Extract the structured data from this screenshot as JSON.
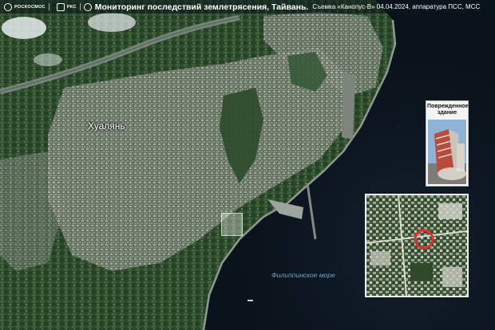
{
  "header": {
    "org_roscosmos": "РОСКОСМОС",
    "org_rks": "РКС",
    "title": "Мониторинг последствий землетрясения, Тайвань.",
    "subtitle": "Съемка «Канопус-В» 04.04.2024, аппаратура ПСС, МСС"
  },
  "labels": {
    "city": "Хуалянь",
    "sea": "Филиппинское море"
  },
  "inset_photo": {
    "caption": "Поврежденное здание"
  },
  "colors": {
    "sea": "#0d1620",
    "land_green": "#2e4a2c",
    "urban": "#8a8f85",
    "sea_label": "#59b6e6",
    "marker": "#e0302c"
  },
  "icons": [
    "roscosmos-logo-icon",
    "rks-logo-icon",
    "emblem-icon",
    "damage-marker-icon"
  ]
}
